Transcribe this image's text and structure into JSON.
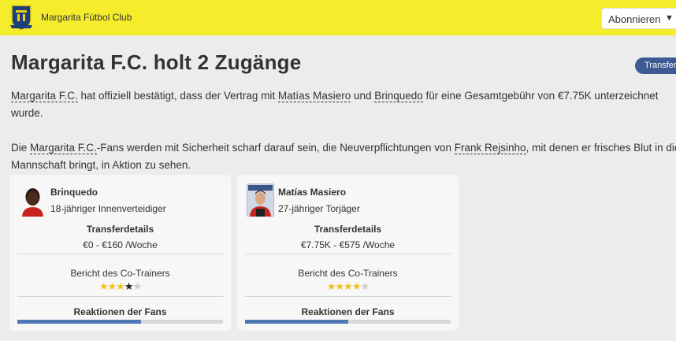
{
  "header": {
    "club_name": "Margarita Fútbol Club",
    "follow_label": "Abonnieren",
    "accent_color": "#f5ec2c"
  },
  "article": {
    "headline": "Margarita F.C. holt 2 Zugänge",
    "category_tag": "Transfers",
    "p1": {
      "club": "Margarita F.C.",
      "text1": " hat offiziell bestätigt, dass der Vertrag mit ",
      "player1": "Matías Masiero",
      "text2": " und ",
      "player2": "Brinquedo",
      "text3": " für eine Gesamtgebühr von €7.75K unterzeichnet wurde."
    },
    "p2": {
      "text1": "Die ",
      "club": "Margarita F.C.",
      "text2": "-Fans werden mit Sicherheit scharf darauf sein, die Neuverpflichtungen von ",
      "manager": "Frank Rejsinho",
      "text3": ", mit denen er frisches Blut in die Mannschaft bringt, in Aktion zu sehen."
    }
  },
  "cards": [
    {
      "name": "Brinquedo",
      "role": "18-jähriger Innenverteidiger",
      "transfer_title": "Transferdetails",
      "fee": "€0 - €160 /Woche",
      "report_title": "Bericht des Co-Trainers",
      "stars": 3.5,
      "fans_title": "Reaktionen der Fans",
      "fans_reaction": 0.6
    },
    {
      "name": "Matías Masiero",
      "role": "27-jähriger Torjäger",
      "transfer_title": "Transferdetails",
      "fee": "€7.75K - €575 /Woche",
      "report_title": "Bericht des Co-Trainers",
      "stars": 4,
      "fans_title": "Reaktionen der Fans",
      "fans_reaction": 0.5
    }
  ]
}
